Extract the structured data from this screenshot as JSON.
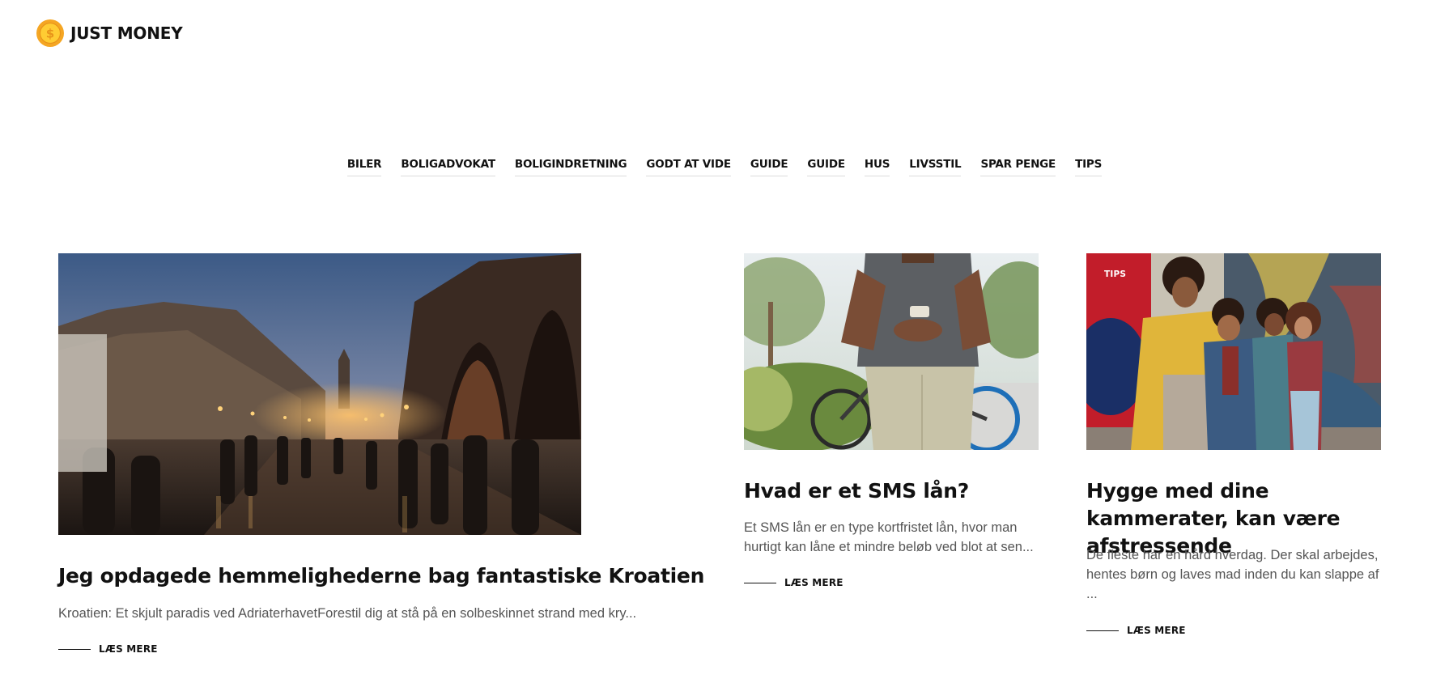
{
  "site": {
    "name": "JUST MONEY",
    "logo_icon": "dollar-coin-icon",
    "logo_symbol": "$",
    "colors": {
      "coin_outer": "#f5a623",
      "coin_inner": "#ffcc33",
      "text": "#111111",
      "excerpt": "#555555"
    }
  },
  "nav": {
    "items": [
      {
        "label": "BILER"
      },
      {
        "label": "BOLIGADVOKAT"
      },
      {
        "label": "BOLIGINDRETNING"
      },
      {
        "label": "GODT AT VIDE"
      },
      {
        "label": "GUIDE"
      },
      {
        "label": "GUIDE"
      },
      {
        "label": "HUS"
      },
      {
        "label": "LIVSSTIL"
      },
      {
        "label": "SPAR PENGE"
      },
      {
        "label": "TIPS"
      }
    ]
  },
  "articles": [
    {
      "title": "Jeg opdagede hemmelighederne bag fantastiske Kroatien",
      "excerpt": "Kroatien: Et skjult paradis ved AdriaterhavetForestil dig at stå på en solbeskinnet strand med kry...",
      "read_more": "LÆS MERE",
      "image": "dubrovnik-evening-street"
    },
    {
      "tag": "",
      "title": "Hvad er et SMS lån?",
      "excerpt": "Et SMS lån er en type kortfristet lån, hvor man hurtigt kan låne et mindre beløb ved blot at sen...",
      "read_more": "LÆS MERE",
      "image": "man-with-phone-and-bicycle"
    },
    {
      "tag": "TIPS",
      "title": "Hygge med dine kammerater, kan være afstressende",
      "excerpt": "De fleste har en hård hverdag. Der skal arbejdes, hentes børn og laves mad inden du kan slappe af ...",
      "read_more": "LÆS MERE",
      "image": "friends-by-graffiti-wall"
    }
  ]
}
